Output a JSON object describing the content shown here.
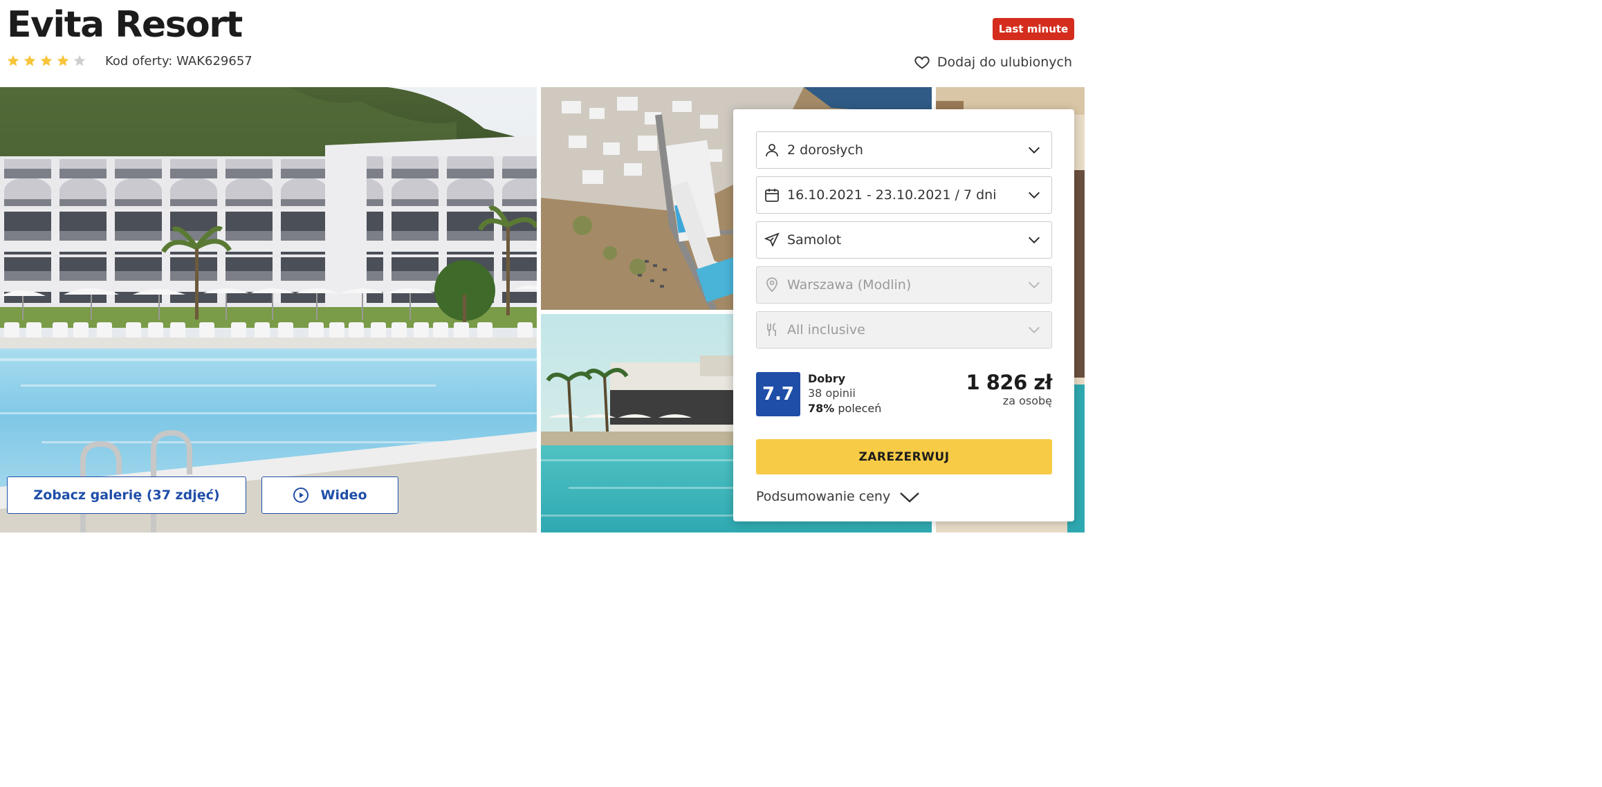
{
  "header": {
    "title": "Evita Resort",
    "stars_filled": 4,
    "stars_total": 5,
    "offer_code": "Kod oferty: WAK629657",
    "badge": "Last minute",
    "favorite_label": "Dodaj do ulubionych"
  },
  "gallery": {
    "gallery_button": "Zobacz galerię (37 zdjęć)",
    "video_button": "Wideo"
  },
  "booking": {
    "fields": [
      {
        "label": "2 dorosłych",
        "icon": "person-icon",
        "disabled": false
      },
      {
        "label": "16.10.2021 - 23.10.2021 / 7 dni",
        "icon": "calendar-icon",
        "disabled": false
      },
      {
        "label": "Samolot",
        "icon": "plane-icon",
        "disabled": false
      },
      {
        "label": "Warszawa (Modlin)",
        "icon": "location-pin-icon",
        "disabled": true
      },
      {
        "label": "All inclusive",
        "icon": "cutlery-icon",
        "disabled": true
      }
    ],
    "rating": {
      "score": "7.7",
      "label": "Dobry",
      "reviews": "38 opinii",
      "recommend_pct": "78%",
      "recommend_text": "poleceń"
    },
    "price": "1 826 zł",
    "price_unit": "za osobę",
    "book_button": "ZAREZERWUJ",
    "summary_label": "Podsumowanie ceny"
  },
  "colors": {
    "accent_blue": "#1f4ea8",
    "badge_red": "#d42d1d",
    "book_yellow": "#f7cb45",
    "star_gold": "#f6c53b",
    "star_grey": "#cfcfcf"
  }
}
